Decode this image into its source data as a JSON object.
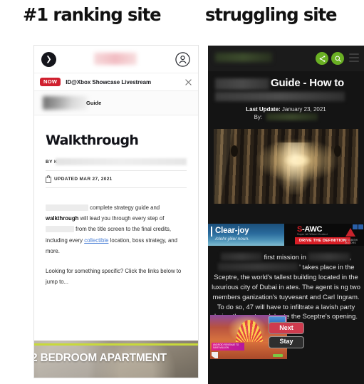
{
  "headings": {
    "left": "#1 ranking site",
    "right": "struggling site"
  },
  "left_phone": {
    "topbar": {
      "back_icon": "chevron-right-icon",
      "logo": "",
      "account_icon": "account-circle-icon"
    },
    "live_banner": {
      "badge": "NOW",
      "text": "ID@Xbox Showcase Livestream",
      "close_icon": "close-icon"
    },
    "breadcrumb": {
      "text": "Guide"
    },
    "article": {
      "title": "Walkthrough",
      "by_label": "BY K",
      "lock_icon": "lock-icon",
      "updated": "UPDATED  MAR 27, 2021",
      "paragraph1_part1": "complete strategy guide and",
      "paragraph1_bold": "walkthrough",
      "paragraph1_part2": "will lead you through every step of",
      "paragraph1_part3": "from the title screen to the final credits, including every",
      "paragraph1_link": "collectible",
      "paragraph1_part4": "location, boss strategy, and more.",
      "paragraph2": "Looking for something specific? Click the links below to jump to..."
    },
    "promo": {
      "text": "2 BEDROOM APARTMENT"
    }
  },
  "right_phone": {
    "topbar": {
      "share_icon": "share-icon",
      "search_icon": "search-icon",
      "menu_icon": "hamburger-menu-icon",
      "accent_color": "#6ab023"
    },
    "title": "Guide - How to",
    "meta": {
      "label": "Last Update:",
      "date": "January 23, 2021",
      "by_label": "By:"
    },
    "hero_image": "game-screenshot-sun-rays-corridor",
    "banner_ad": {
      "left_title": "Clear-joy",
      "left_sub": "/clehr-jðie/ noun.",
      "right_brand": "S-AWC",
      "right_brand_sub": "Super All Wheel Control",
      "right_cta": "DRIVE THE DEFINITION",
      "right_logo": "mitsubishi-triangle-logo",
      "right_logo_label": "MITSUBISHI MOTORS",
      "adchoices_icon": "adchoices-icon"
    },
    "body": {
      "line1_mid": "first mission in",
      "line1_end": ",",
      "line2_end": "' takes place in",
      "line3": "the Sceptre, the world's tallest building",
      "line4": "located in the luxurious city of Dubai in",
      "line5_end": "ates. The agent is",
      "line6_end": "ng two members",
      "line7_end": "ganization's",
      "line8_end": "tuyvesant and Carl",
      "line9": "Ingram. To do so, 47 will have to",
      "line10": "infiltrate a lavish party being thrown to",
      "line11": "celebrate the Sceptre's opening."
    },
    "overlay_ad": {
      "image": "racing-game-ad",
      "tag_text": "ANDROID REVENUE TO SAVE MILLION",
      "play_icon": "play-badge-icon",
      "choices": [
        {
          "label": "Next",
          "color": "#cf3b4e"
        },
        {
          "label": "Stay",
          "color": "#2e2e2e"
        }
      ]
    }
  }
}
